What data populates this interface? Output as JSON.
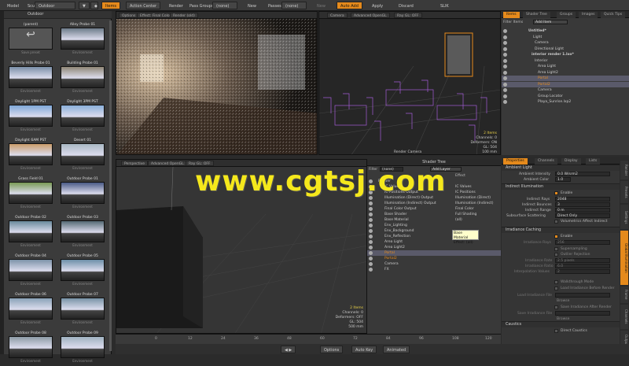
{
  "toolbar": {
    "items": [
      "Model",
      "Sculpt",
      "Outdoor",
      "Items",
      "Action Center",
      "Render",
      "Pass Groups",
      "(none)",
      "New",
      "Passes",
      "(none)",
      "New",
      "Auto Add",
      "Apply",
      "Discard",
      "SLIK"
    ]
  },
  "browser": {
    "header": "Outdoor",
    "presets": [
      {
        "label": "(parent)",
        "sub": "Save preset",
        "t": "folder"
      },
      {
        "label": "Alley Probe 01",
        "sub": "Environment",
        "t": "#6d7c8a"
      },
      {
        "label": "Beverly Hills Probe 01",
        "sub": "Environment",
        "t": "#7a8ea6"
      },
      {
        "label": "Building Probe 01",
        "sub": "Environment",
        "t": "#8e8676"
      },
      {
        "label": "Daylight 1PM PST",
        "sub": "Environment",
        "t": "#7fa8d8"
      },
      {
        "label": "Daylight 3PM PST",
        "sub": "Environment",
        "t": "#8bb0da"
      },
      {
        "label": "Daylight 6AM PST",
        "sub": "Environment",
        "t": "#c99c6a"
      },
      {
        "label": "Desert 01",
        "sub": "Environment",
        "t": "#a9b8c4"
      },
      {
        "label": "Grass Field 01",
        "sub": "Environment",
        "t": "#7a9a55"
      },
      {
        "label": "Outdoor Probe 01",
        "sub": "Environment",
        "t": "#4a5a86"
      },
      {
        "label": "Outdoor Probe 02",
        "sub": "Environment",
        "t": "#6a8a9c"
      },
      {
        "label": "Outdoor Probe 03",
        "sub": "Environment",
        "t": "#556a74"
      },
      {
        "label": "Outdoor Probe 04",
        "sub": "Environment",
        "t": "#7c92a8"
      },
      {
        "label": "Outdoor Probe 05",
        "sub": "Environment",
        "t": "#6d8fa8"
      },
      {
        "label": "Outdoor Probe 06",
        "sub": "Environment",
        "t": "#8aa3b8"
      },
      {
        "label": "Outdoor Probe 07",
        "sub": "Environment",
        "t": "#7893a6"
      },
      {
        "label": "Outdoor Probe 08",
        "sub": "Environment",
        "t": "#8c9aa4"
      },
      {
        "label": "Outdoor Probe 09",
        "sub": "Environment",
        "t": "#9fb2c0"
      }
    ]
  },
  "vp_render": {
    "tabs": [
      "Options",
      "Effect: Final Color",
      "Render (old)"
    ]
  },
  "vp_camera": {
    "tabs": [
      "Camera",
      "Advanced OpenGL",
      "Ray GL: OFF"
    ],
    "info": [
      "2 Items",
      "Channels: 0",
      "Deformers: ON",
      "GL: 504",
      "100 mm"
    ],
    "label": "Render Camera"
  },
  "vp_persp": {
    "tabs": [
      "Perspective",
      "Advanced OpenGL",
      "Ray GL: OFF"
    ],
    "info": [
      "2 Items",
      "Channels: 0",
      "Deformers: OFF",
      "GL: 504",
      "500 mm"
    ]
  },
  "shader": {
    "title": "Shader Tree",
    "filter": "Filter",
    "filter_val": "(none)",
    "add": "Add Layer",
    "col": "Effect",
    "rows": [
      {
        "n": "Render",
        "e": "",
        "c": ""
      },
      {
        "n": "IC Values",
        "e": "IC Values",
        "c": ""
      },
      {
        "n": "IC Positions Output",
        "e": "IC Positions",
        "c": ""
      },
      {
        "n": "Illumination (Direct) Output",
        "e": "Illumination (Direct)",
        "c": ""
      },
      {
        "n": "Illumination (Indirect) Output",
        "e": "Illumination (Indirect)",
        "c": ""
      },
      {
        "n": "Final Color Output",
        "e": "Final Color",
        "c": ""
      },
      {
        "n": "Base Shader",
        "e": "Full Shading",
        "c": ""
      },
      {
        "n": "Base Material",
        "e": "(all)",
        "c": ""
      },
      {
        "n": "Env_Lighting",
        "e": "",
        "c": ""
      },
      {
        "n": "Env_Background",
        "e": "",
        "c": ""
      },
      {
        "n": "Env_Reflection",
        "e": "",
        "c": ""
      },
      {
        "n": "Area Light",
        "e": "",
        "c": ""
      },
      {
        "n": "Area Light2",
        "e": "",
        "c": ""
      },
      {
        "n": "Portal",
        "e": "",
        "c": "o"
      },
      {
        "n": "Portal2",
        "e": "",
        "c": "o"
      },
      {
        "n": "Camera",
        "e": "",
        "c": ""
      },
      {
        "n": "FX",
        "e": "",
        "c": ""
      }
    ],
    "tooltip": [
      "Base Material",
      "Effect: (all)"
    ]
  },
  "items": {
    "tabs": [
      "Items",
      "Shader Tree",
      "Groups",
      "Images",
      "Quick Tips"
    ],
    "filter": "Filter Items",
    "add": "Add Item",
    "rows": [
      "Untitled*",
      "Light",
      "Camera",
      "Directional Light",
      "interior render 1.lxo*",
      "Interior",
      "Area Light",
      "Area Light2",
      "Portal",
      "Portal2",
      "Camera",
      "Group Locator",
      "Playa_Sunrise.lxp2"
    ]
  },
  "props": {
    "tabs": [
      "Properties",
      "Channels",
      "Display",
      "Lists"
    ],
    "ambient": {
      "title": "Ambient Light",
      "intensity_l": "Ambient Intensity",
      "intensity_v": "0.0 W/srm2",
      "color_l": "Ambient Color",
      "color_v": "1.0"
    },
    "indirect": {
      "title": "Indirect Illumination",
      "enable": "Enable",
      "rays_l": "Indirect Rays",
      "rays_v": "2048",
      "bounces_l": "Indirect Bounces",
      "bounces_v": "3",
      "range_l": "Indirect Range",
      "range_v": "0 m",
      "sub_l": "Subsurface Scattering",
      "sub_v": "Direct Only",
      "vol": "Volumetrics Affect Indirect"
    },
    "cache": {
      "title": "Irradiance Caching",
      "enable": "Enable",
      "rays_l": "Irradiance Rays",
      "rays_v": "256",
      "super": "Supersampling",
      "outlier": "Outlier Rejection",
      "rate_l": "Irradiance Rate",
      "rate_v": "2.5 pixels",
      "ratio_l": "Irradiance Ratio",
      "ratio_v": "6.0",
      "interp_l": "Interpolation Values",
      "interp_v": "2",
      "walk": "Walkthrough Mode",
      "load_b": "Load Irradiance Before Render",
      "load_l": "Load Irradiance File",
      "browse": "Browse",
      "save_a": "Save Irradiance After Render",
      "save_l": "Save Irradiance File"
    },
    "caustics": {
      "title": "Caustics",
      "direct": "Direct Caustics"
    },
    "sidetabs": [
      "Render",
      "Presets",
      "Settings",
      "Global Illumination",
      "Frame",
      "Channels",
      "Output"
    ]
  },
  "timeline": {
    "ticks": [
      "0",
      "12",
      "24",
      "36",
      "48",
      "60",
      "72",
      "84",
      "96",
      "108",
      "120"
    ]
  },
  "bottom": {
    "items": [
      "Options",
      "Auto Key",
      "Animated"
    ]
  },
  "watermark": "www.cgtsj.com",
  "colors": {
    "accent": "#e58a1c",
    "watermark": "#f5e81c"
  }
}
